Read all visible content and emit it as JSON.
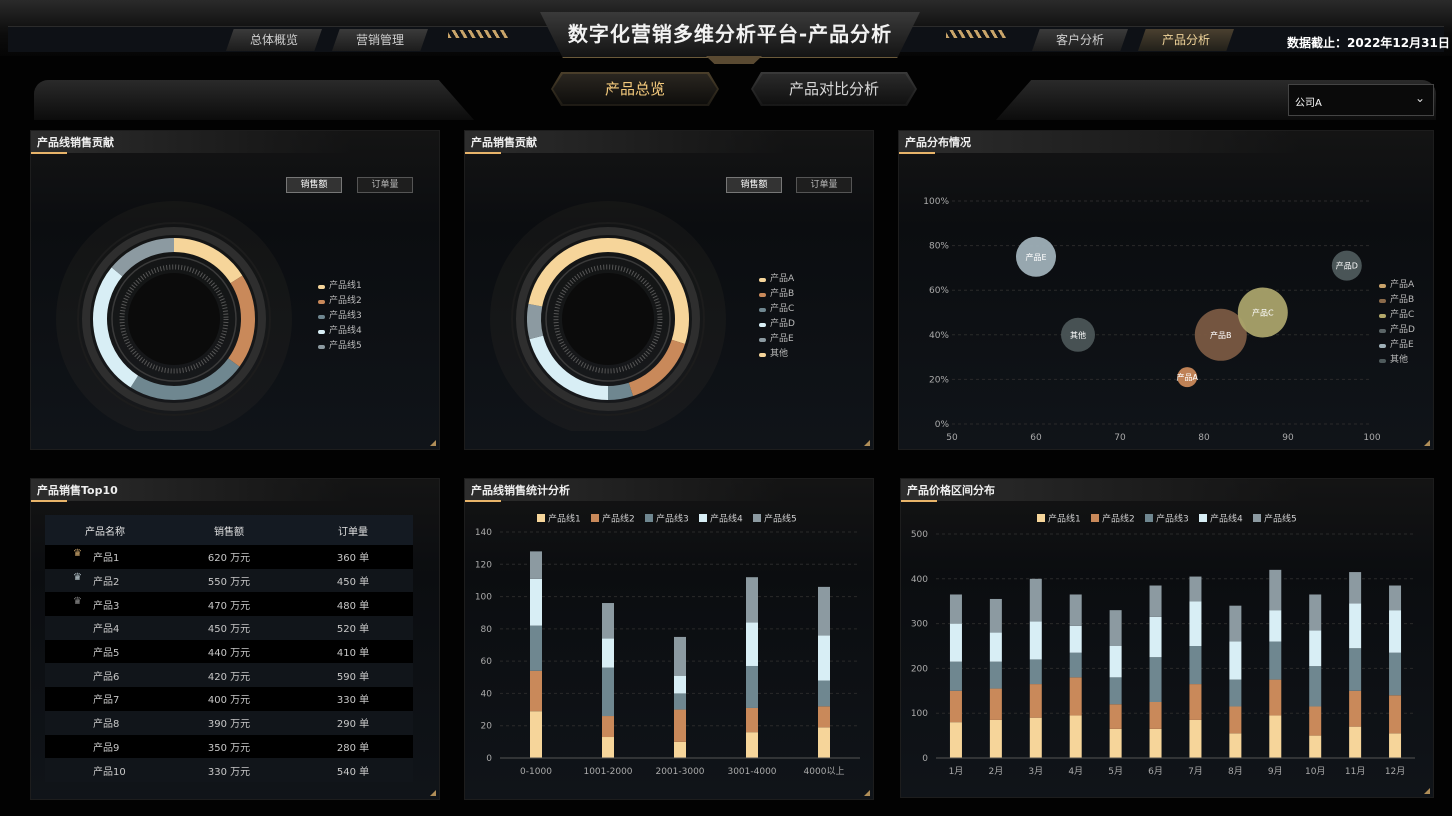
{
  "header": {
    "title": "数字化营销多维分析平台-产品分析",
    "date_label": "数据截止：",
    "date_value": "2022年12月31日",
    "nav": [
      {
        "label": "总体概览"
      },
      {
        "label": "营销管理"
      },
      {
        "label": "客户分析"
      },
      {
        "label": "产品分析"
      }
    ]
  },
  "subnav": {
    "tabs": [
      {
        "label": "产品总览"
      },
      {
        "label": "产品对比分析"
      }
    ],
    "company_select": "公司A"
  },
  "colors": {
    "series": [
      "#f6d59a",
      "#c9895a",
      "#6f8790",
      "#d8eef5",
      "#8c9aa1"
    ],
    "accent": "#e8b46a"
  },
  "panel1": {
    "title": "产品线销售贡献",
    "toggle": [
      "销售额",
      "订单量"
    ],
    "legend": [
      "产品线1",
      "产品线2",
      "产品线3",
      "产品线4",
      "产品线5"
    ],
    "chart_data": {
      "type": "pie",
      "labels": [
        "产品线1",
        "产品线2",
        "产品线3",
        "产品线4",
        "产品线5"
      ],
      "values": [
        16,
        19,
        24,
        27,
        14
      ]
    }
  },
  "panel2": {
    "title": "产品销售贡献",
    "toggle": [
      "销售额",
      "订单量"
    ],
    "legend": [
      "产品A",
      "产品B",
      "产品C",
      "产品D",
      "产品E",
      "其他"
    ],
    "chart_data": {
      "type": "pie",
      "labels": [
        "产品A",
        "产品B",
        "产品C",
        "产品D",
        "产品E",
        "其他"
      ],
      "values": [
        30,
        15,
        5,
        21,
        7,
        22
      ]
    }
  },
  "panel3": {
    "title": "产品分布情况",
    "legend": [
      "产品A",
      "产品B",
      "产品C",
      "产品D",
      "产品E",
      "其他"
    ],
    "chart_data": {
      "type": "scatter",
      "xlim": [
        50,
        100
      ],
      "ylim": [
        0,
        100
      ],
      "x_ticks": [
        "50",
        "60",
        "70",
        "80",
        "90",
        "100"
      ],
      "y_ticks": [
        "0%",
        "20%",
        "40%",
        "60%",
        "80%",
        "100%"
      ],
      "points": [
        {
          "name": "产品A",
          "x": 78,
          "y": 21,
          "size": 10
        },
        {
          "name": "产品B",
          "x": 82,
          "y": 40,
          "size": 26
        },
        {
          "name": "产品C",
          "x": 87,
          "y": 50,
          "size": 25
        },
        {
          "name": "产品D",
          "x": 97,
          "y": 71,
          "size": 15
        },
        {
          "name": "产品E",
          "x": 60,
          "y": 75,
          "size": 20
        },
        {
          "name": "其他",
          "x": 65,
          "y": 40,
          "size": 17
        }
      ],
      "point_colors": [
        "#c9895a",
        "#7a5a42",
        "#aaa36a",
        "#4e5a5c",
        "#9fb0b8",
        "#4b5556"
      ]
    }
  },
  "panel4": {
    "title": "产品销售Top10",
    "headers": [
      "产品名称",
      "销售额",
      "订单量"
    ],
    "rows": [
      [
        "产品1",
        "620 万元",
        "360 单"
      ],
      [
        "产品2",
        "550 万元",
        "450 单"
      ],
      [
        "产品3",
        "470 万元",
        "480 单"
      ],
      [
        "产品4",
        "450 万元",
        "520 单"
      ],
      [
        "产品5",
        "440 万元",
        "410 单"
      ],
      [
        "产品6",
        "420 万元",
        "590 单"
      ],
      [
        "产品7",
        "400 万元",
        "330 单"
      ],
      [
        "产品8",
        "390 万元",
        "290 单"
      ],
      [
        "产品9",
        "350 万元",
        "280 单"
      ],
      [
        "产品10",
        "330 万元",
        "540 单"
      ]
    ]
  },
  "panel5": {
    "title": "产品线销售统计分析",
    "chart_data": {
      "type": "bar",
      "stacked": true,
      "categories": [
        "0-1000",
        "1001-2000",
        "2001-3000",
        "3001-4000",
        "4000以上"
      ],
      "ylim": [
        0,
        140
      ],
      "yticks": [
        0,
        20,
        40,
        60,
        80,
        100,
        120,
        140
      ],
      "series": [
        {
          "name": "产品线1",
          "values": [
            29,
            13,
            10,
            16,
            19
          ]
        },
        {
          "name": "产品线2",
          "values": [
            25,
            13,
            20,
            15,
            13
          ]
        },
        {
          "name": "产品线3",
          "values": [
            28,
            30,
            10,
            26,
            16
          ]
        },
        {
          "name": "产品线4",
          "values": [
            29,
            18,
            11,
            27,
            28
          ]
        },
        {
          "name": "产品线5",
          "values": [
            17,
            22,
            24,
            28,
            30
          ]
        }
      ]
    }
  },
  "panel6": {
    "title": "产品价格区间分布",
    "chart_data": {
      "type": "bar",
      "stacked": true,
      "categories": [
        "1月",
        "2月",
        "3月",
        "4月",
        "5月",
        "6月",
        "7月",
        "8月",
        "9月",
        "10月",
        "11月",
        "12月"
      ],
      "ylim": [
        0,
        500
      ],
      "yticks": [
        0,
        100,
        200,
        300,
        400,
        500
      ],
      "series": [
        {
          "name": "产品线1",
          "values": [
            80,
            85,
            90,
            95,
            65,
            65,
            85,
            55,
            95,
            50,
            70,
            55
          ]
        },
        {
          "name": "产品线2",
          "values": [
            70,
            70,
            75,
            85,
            55,
            60,
            80,
            60,
            80,
            65,
            80,
            85
          ]
        },
        {
          "name": "产品线3",
          "values": [
            65,
            60,
            55,
            55,
            60,
            100,
            85,
            60,
            85,
            90,
            95,
            95
          ]
        },
        {
          "name": "产品线4",
          "values": [
            85,
            65,
            85,
            60,
            70,
            90,
            100,
            85,
            70,
            80,
            100,
            95
          ]
        },
        {
          "name": "产品线5",
          "values": [
            65,
            75,
            95,
            70,
            80,
            70,
            55,
            80,
            90,
            80,
            70,
            55
          ]
        }
      ]
    }
  }
}
